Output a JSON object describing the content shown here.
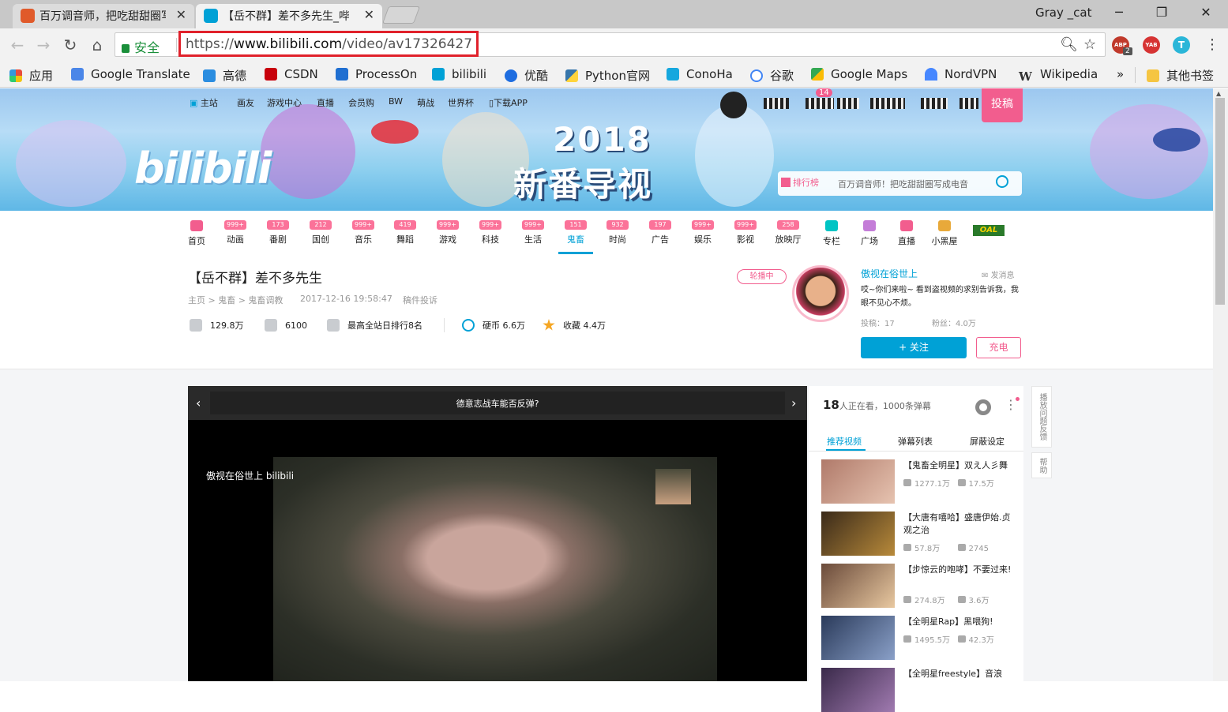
{
  "browser": {
    "tabs": [
      {
        "title": "百万调音师，把吃甜甜圈写成...",
        "active": false
      },
      {
        "title": "【岳不群】差不多先生_哔哩",
        "active": true
      }
    ],
    "user": "Gray _cat",
    "security_label": "安全",
    "url_scheme": "https://",
    "url_host": "www.bilibili.com",
    "url_path": "/video/av17326427",
    "extensions": [
      {
        "name": "ABP",
        "color": "#c0392b",
        "badge": "2"
      },
      {
        "name": "YAB",
        "color": "#d63333"
      },
      {
        "name": "T",
        "color": "#2ab6d8"
      }
    ],
    "bookmarks": [
      {
        "label": "应用",
        "color": "#e74c3c"
      },
      {
        "label": "Google Translate",
        "color": "#4a86e8"
      },
      {
        "label": "高德",
        "color": "#2b8de0"
      },
      {
        "label": "CSDN",
        "color": "#c7000b"
      },
      {
        "label": "ProcessOn",
        "color": "#1f6fd1"
      },
      {
        "label": "bilibili",
        "color": "#00a1d6"
      },
      {
        "label": "优酷",
        "color": "#1e6de0"
      },
      {
        "label": "Python官网",
        "color": "#3776ab"
      },
      {
        "label": "ConoHa",
        "color": "#15a7de"
      },
      {
        "label": "谷歌",
        "color": "#4285f4"
      },
      {
        "label": "Google Maps",
        "color": "#34a853"
      },
      {
        "label": "NordVPN",
        "color": "#4687ff"
      },
      {
        "label": "Wikipedia",
        "color": "#555555"
      }
    ],
    "more_bookmarks": "»",
    "other_bookmarks": "其他书签"
  },
  "site": {
    "topnav": [
      "主站",
      "画友",
      "游戏中心",
      "直播",
      "会员购",
      "BW",
      "萌战",
      "世界杯",
      "下载APP"
    ],
    "notif_count": "14",
    "upload_label": "投稿",
    "logo_text": "bilibili",
    "banner_year": "2018",
    "banner_title": "新番导视",
    "rank_label": "排行榜",
    "search_placeholder": "百万调音师！把吃甜甜圈写成电音",
    "categories": [
      {
        "label": "首页",
        "count": ""
      },
      {
        "label": "动画",
        "count": "999+"
      },
      {
        "label": "番剧",
        "count": "173"
      },
      {
        "label": "国创",
        "count": "212"
      },
      {
        "label": "音乐",
        "count": "999+"
      },
      {
        "label": "舞蹈",
        "count": "419"
      },
      {
        "label": "游戏",
        "count": "999+"
      },
      {
        "label": "科技",
        "count": "999+"
      },
      {
        "label": "生活",
        "count": "999+"
      },
      {
        "label": "鬼畜",
        "count": "151"
      },
      {
        "label": "时尚",
        "count": "932"
      },
      {
        "label": "广告",
        "count": "197"
      },
      {
        "label": "娱乐",
        "count": "999+"
      },
      {
        "label": "影视",
        "count": "999+"
      },
      {
        "label": "放映厅",
        "count": "258"
      },
      {
        "label": "专栏",
        "count": ""
      },
      {
        "label": "广场",
        "count": ""
      },
      {
        "label": "直播",
        "count": ""
      },
      {
        "label": "小黑屋",
        "count": ""
      }
    ],
    "active_category": "鬼畜",
    "extra_logo": "OAL"
  },
  "video": {
    "title": "【岳不群】差不多先生",
    "breadcrumb": "主页 > 鬼畜 > 鬼畜调教",
    "date": "2017-12-16 19:58:47",
    "report": "稿件投诉",
    "plays": "129.8万",
    "danmaku": "6100",
    "rank": "最高全站日排行8名",
    "coins": "硬币 6.6万",
    "favorites": "收藏 4.4万",
    "player_title": "德意志战车能否反弹?",
    "watermark": "傲视在俗世上 bilibili"
  },
  "uploader": {
    "live_badge": "轮播中",
    "name": "傲视在俗世上",
    "message": "发消息",
    "desc": "哎~你们来啦~ 看到盗视频的求别告诉我，我眼不见心不烦。",
    "submissions": "投稿：17",
    "fans": "粉丝：4.0万",
    "follow": "+ 关注",
    "charge": "充电"
  },
  "sidebar": {
    "watching_count": "18",
    "watching_text": "人正在看，1000条弹幕",
    "tabs": [
      "推荐视频",
      "弹幕列表",
      "屏蔽设定"
    ],
    "recommendations": [
      {
        "title": "【鬼畜全明星】双え人彡舞",
        "plays": "1277.1万",
        "danmaku": "17.5万",
        "thumb": "#b07a6a"
      },
      {
        "title": "【大唐有嘻哈】盛唐伊始.贞观之治",
        "plays": "57.8万",
        "danmaku": "2745",
        "thumb": "#6b4a2a"
      },
      {
        "title": "【步惊云的咆哮】不要过来!",
        "plays": "274.8万",
        "danmaku": "3.6万",
        "thumb": "#c9a07a"
      },
      {
        "title": "【全明星Rap】黑喂狗!",
        "plays": "1495.5万",
        "danmaku": "42.3万",
        "thumb": "#3a5a8a"
      },
      {
        "title": "【全明星freestyle】音浪",
        "plays": "",
        "danmaku": "",
        "thumb": "#5a3a6a"
      }
    ],
    "feedback": "播放问题反馈",
    "help": "帮助"
  }
}
